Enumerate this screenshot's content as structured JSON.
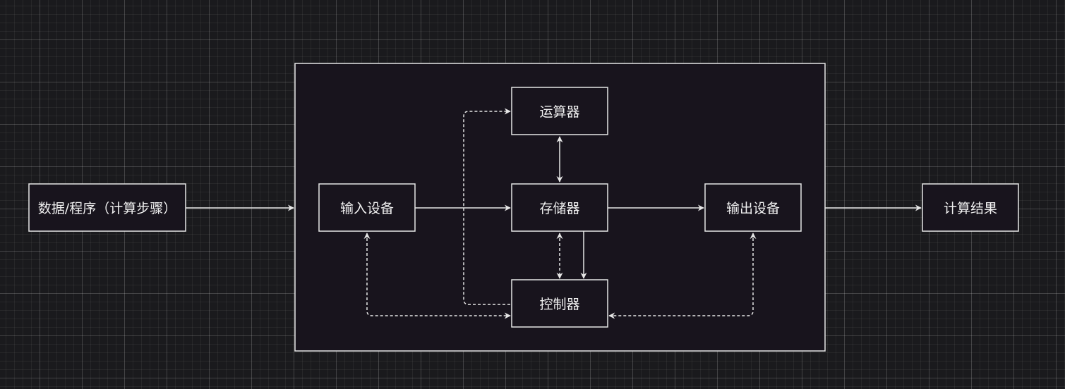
{
  "colors": {
    "background": "#1a1a1d",
    "node_fill": "#18141d",
    "stroke": "#e6e6e6",
    "text": "#f2f2f2"
  },
  "nodes": {
    "source": "数据/程序（计算步骤）",
    "input": "输入设备",
    "alu": "运算器",
    "memory": "存储器",
    "controller": "控制器",
    "output": "输出设备",
    "result": "计算结果"
  },
  "edges": [
    {
      "from": "source",
      "to": "computer",
      "style": "solid"
    },
    {
      "from": "input",
      "to": "memory",
      "style": "solid"
    },
    {
      "from": "memory",
      "to": "output",
      "style": "solid"
    },
    {
      "from": "output",
      "to": "result",
      "style": "solid"
    },
    {
      "from": "alu",
      "to": "memory",
      "style": "solid",
      "bidirectional": true
    },
    {
      "from": "memory",
      "to": "controller",
      "style": "solid"
    },
    {
      "from": "memory",
      "to": "controller",
      "style": "dashed",
      "bidirectional": true
    },
    {
      "from": "controller",
      "to": "alu",
      "style": "dashed"
    },
    {
      "from": "input",
      "to": "controller",
      "style": "dashed",
      "bidirectional": true
    },
    {
      "from": "output",
      "to": "controller",
      "style": "dashed",
      "bidirectional": true
    }
  ]
}
